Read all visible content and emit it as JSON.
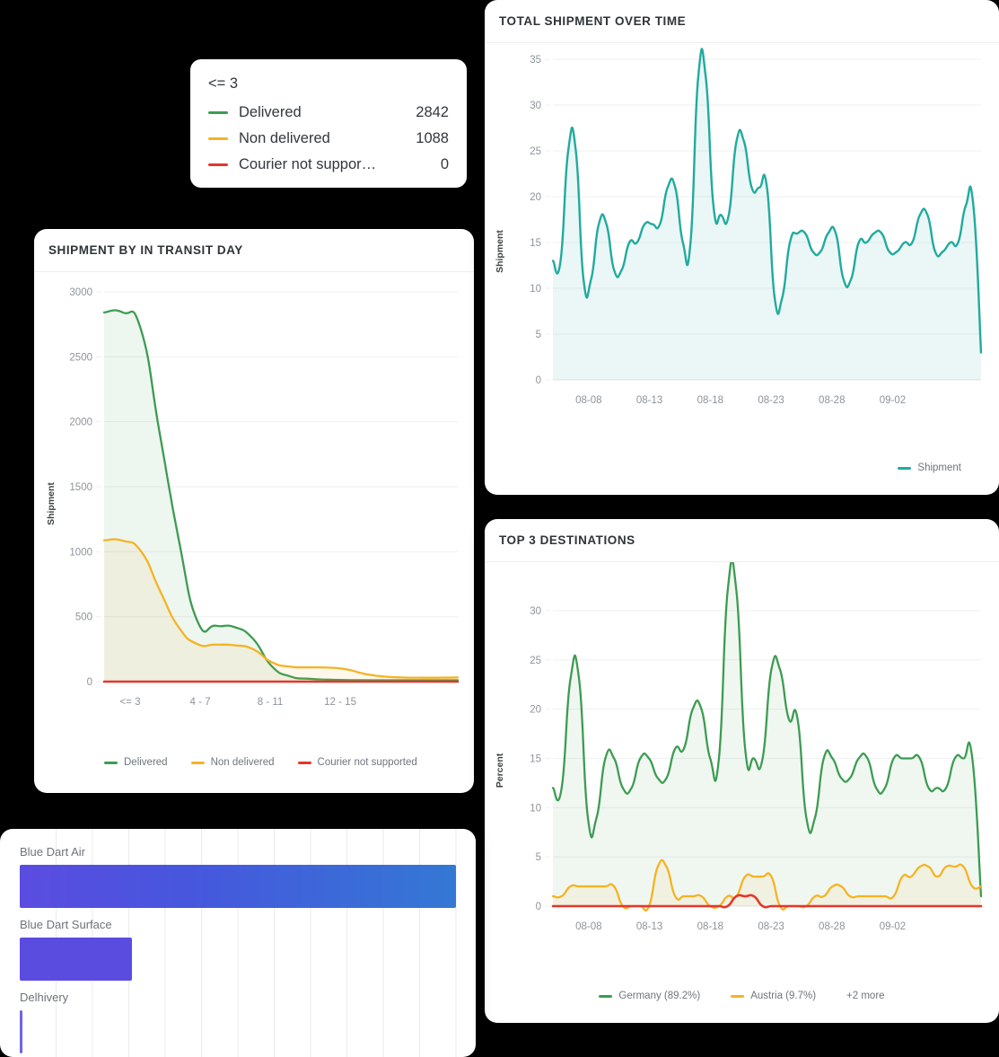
{
  "tooltip": {
    "header": "<= 3",
    "rows": [
      {
        "name": "Delivered",
        "value": "2842",
        "color": "#3d9c52"
      },
      {
        "name": "Non delivered",
        "value": "1088",
        "color": "#f5b323"
      },
      {
        "name": "Courier not suppor…",
        "value": "0",
        "color": "#e8352a"
      }
    ]
  },
  "transit_panel": {
    "title": "SHIPMENT BY IN TRANSIT DAY"
  },
  "shipment_panel": {
    "title": "TOTAL SHIPMENT OVER TIME"
  },
  "destinations_panel": {
    "title": "TOP 3 DESTINATIONS"
  },
  "transit_legend": [
    {
      "label": "Delivered",
      "color": "#3d9c52"
    },
    {
      "label": "Non delivered",
      "color": "#f5b323"
    },
    {
      "label": "Courier not supported",
      "color": "#e8352a"
    }
  ],
  "shipment_legend": [
    {
      "label": "Shipment",
      "color": "#21ab9e"
    }
  ],
  "destinations_legend": [
    {
      "label": "Germany (89.2%)",
      "color": "#3d9c52"
    },
    {
      "label": "Austria (9.7%)",
      "color": "#f5b323"
    }
  ],
  "destinations_legend_more": "+2 more",
  "bars": {
    "items": [
      {
        "label": "Blue Dart Air",
        "pct": 100.0,
        "fill": "gradient"
      },
      {
        "label": "Blue Dart Surface",
        "pct": 25.7,
        "fill": "#5b4ce0"
      },
      {
        "label": "Delhivery",
        "pct": 0.35,
        "fill": "#6f63e8"
      }
    ],
    "gradient_from": "#5b4ce0",
    "gradient_to": "#3478d4",
    "gridlines": 12
  },
  "chart_data": [
    {
      "type": "area",
      "title": "SHIPMENT BY IN TRANSIT DAY",
      "xlabel": "",
      "ylabel": "Shipment",
      "categories": [
        "<= 3",
        "4 - 7",
        "8 - 11",
        "12 - 15"
      ],
      "xticks": [
        "<= 3",
        "4 - 7",
        "8 - 11",
        "12 - 15"
      ],
      "yticks": [
        0,
        500,
        1000,
        1500,
        2000,
        2500,
        3000
      ],
      "ylim": [
        0,
        3000
      ],
      "grid": true,
      "legend_position": "bottom",
      "series": [
        {
          "name": "Delivered",
          "color": "#3d9c52",
          "values": [
            2842,
            430,
            30,
            12,
            10
          ]
        },
        {
          "name": "Non delivered",
          "color": "#f5b323",
          "values": [
            1088,
            280,
            120,
            40,
            30
          ]
        },
        {
          "name": "Courier not supported",
          "color": "#e8352a",
          "values": [
            0,
            0,
            0,
            0,
            0
          ]
        }
      ]
    },
    {
      "type": "area",
      "title": "TOTAL SHIPMENT OVER TIME",
      "xlabel": "",
      "ylabel": "Shipment",
      "xticks": [
        "08-08",
        "08-13",
        "08-18",
        "08-23",
        "08-28",
        "09-02"
      ],
      "yticks": [
        0,
        5,
        10,
        15,
        20,
        25,
        30,
        35
      ],
      "ylim": [
        0,
        35
      ],
      "grid": true,
      "legend_position": "bottom-right",
      "series": [
        {
          "name": "Shipment",
          "color": "#21ab9e",
          "values": [
            13,
            25,
            11,
            17,
            12,
            15,
            17,
            17,
            21,
            15,
            33,
            19,
            18,
            26,
            21,
            21,
            9,
            15,
            16,
            14,
            16,
            11,
            15,
            15,
            18,
            14,
            15,
            19,
            3
          ]
        }
      ]
    },
    {
      "type": "area",
      "title": "TOP 3 DESTINATIONS",
      "xlabel": "",
      "ylabel": "Percent",
      "xticks": [
        "08-08",
        "08-13",
        "08-18",
        "08-23",
        "08-28",
        "09-02"
      ],
      "yticks": [
        0,
        5,
        10,
        15,
        20,
        25,
        30
      ],
      "ylim": [
        0,
        32
      ],
      "grid": true,
      "legend_position": "bottom",
      "series": [
        {
          "name": "Germany (89.2%)",
          "color": "#3d9c52",
          "values": [
            12,
            23,
            9,
            15,
            12,
            15,
            13,
            16,
            20,
            15,
            32,
            16,
            15,
            24,
            19,
            9,
            15,
            13,
            15,
            12,
            15,
            15,
            12,
            15,
            11,
            10,
            15,
            15,
            1
          ]
        },
        {
          "name": "Austria (9.7%)",
          "color": "#f5b323",
          "values": [
            1,
            2,
            2,
            2,
            0,
            0,
            4,
            1,
            1,
            0,
            1,
            3,
            3,
            0,
            0,
            1,
            2,
            1,
            1,
            1,
            3,
            4,
            3,
            4,
            4,
            2
          ]
        },
        {
          "name": "Courier not supported",
          "color": "#e8352a",
          "values": [
            0,
            0,
            0,
            0,
            0,
            0,
            0,
            0,
            0,
            1,
            1,
            0,
            0,
            0,
            0,
            0,
            0,
            0,
            0,
            0,
            0,
            0
          ]
        }
      ]
    }
  ]
}
